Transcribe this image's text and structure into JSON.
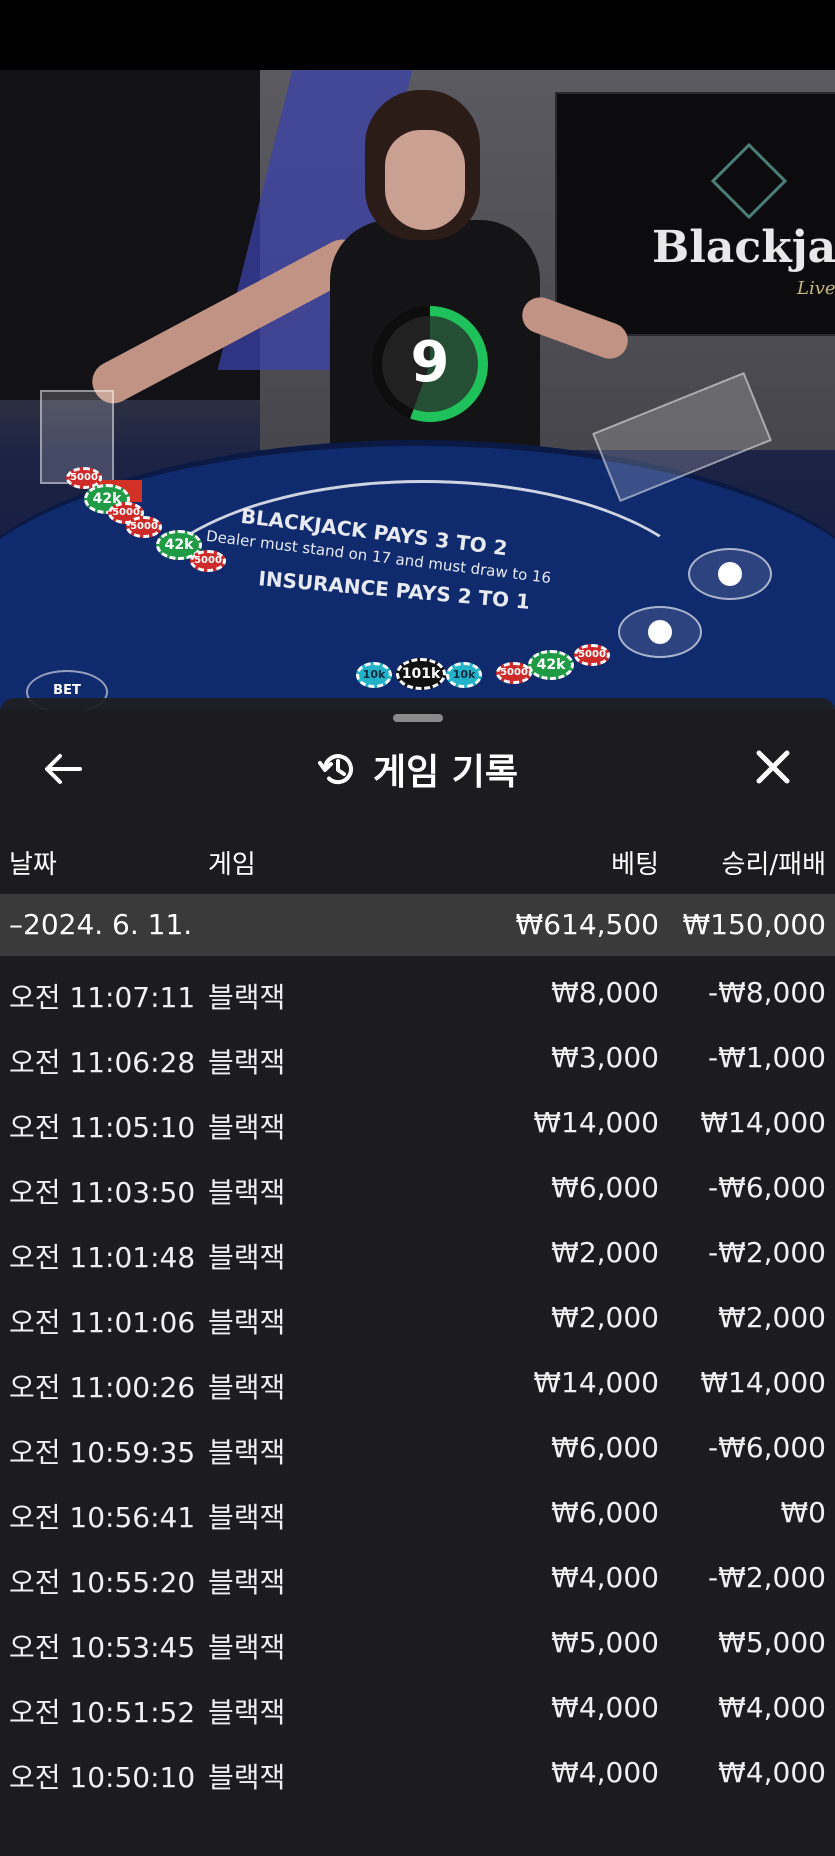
{
  "video": {
    "tv_logo_text": "Blackjack",
    "tv_logo_sub": "Live",
    "timer_value": "9",
    "felt_line1": "BLACKJACK PAYS 3 TO 2",
    "felt_line2": "Dealer must stand on 17 and must draw to 16",
    "felt_line3": "INSURANCE PAYS 2 TO 1",
    "chips": {
      "red": "5000",
      "green": "42k",
      "blue": "10k",
      "black": "101k"
    },
    "bet_behind": "BET"
  },
  "panel": {
    "title": "게임 기록",
    "columns": {
      "date": "날짜",
      "game": "게임",
      "bet": "베팅",
      "win_loss": "승리/패배"
    },
    "day": {
      "label": "–2024. 6. 11.",
      "total_bet": "₩614,500",
      "total_win": "₩150,000"
    },
    "rows": [
      {
        "time": "오전 11:07:11",
        "game": "블랙잭",
        "bet": "₩8,000",
        "result": "-₩8,000"
      },
      {
        "time": "오전 11:06:28",
        "game": "블랙잭",
        "bet": "₩3,000",
        "result": "-₩1,000"
      },
      {
        "time": "오전 11:05:10",
        "game": "블랙잭",
        "bet": "₩14,000",
        "result": "₩14,000"
      },
      {
        "time": "오전 11:03:50",
        "game": "블랙잭",
        "bet": "₩6,000",
        "result": "-₩6,000"
      },
      {
        "time": "오전 11:01:48",
        "game": "블랙잭",
        "bet": "₩2,000",
        "result": "-₩2,000"
      },
      {
        "time": "오전 11:01:06",
        "game": "블랙잭",
        "bet": "₩2,000",
        "result": "₩2,000"
      },
      {
        "time": "오전 11:00:26",
        "game": "블랙잭",
        "bet": "₩14,000",
        "result": "₩14,000"
      },
      {
        "time": "오전 10:59:35",
        "game": "블랙잭",
        "bet": "₩6,000",
        "result": "-₩6,000"
      },
      {
        "time": "오전 10:56:41",
        "game": "블랙잭",
        "bet": "₩6,000",
        "result": "₩0"
      },
      {
        "time": "오전 10:55:20",
        "game": "블랙잭",
        "bet": "₩4,000",
        "result": "-₩2,000"
      },
      {
        "time": "오전 10:53:45",
        "game": "블랙잭",
        "bet": "₩5,000",
        "result": "₩5,000"
      },
      {
        "time": "오전 10:51:52",
        "game": "블랙잭",
        "bet": "₩4,000",
        "result": "₩4,000"
      },
      {
        "time": "오전 10:50:10",
        "game": "블랙잭",
        "bet": "₩4,000",
        "result": "₩4,000"
      }
    ]
  },
  "colors": {
    "panel_bg": "#1e1e20",
    "day_row_bg": "#3a3a3a",
    "timer_green": "#1fc15a",
    "felt_blue": "#102a6e"
  }
}
